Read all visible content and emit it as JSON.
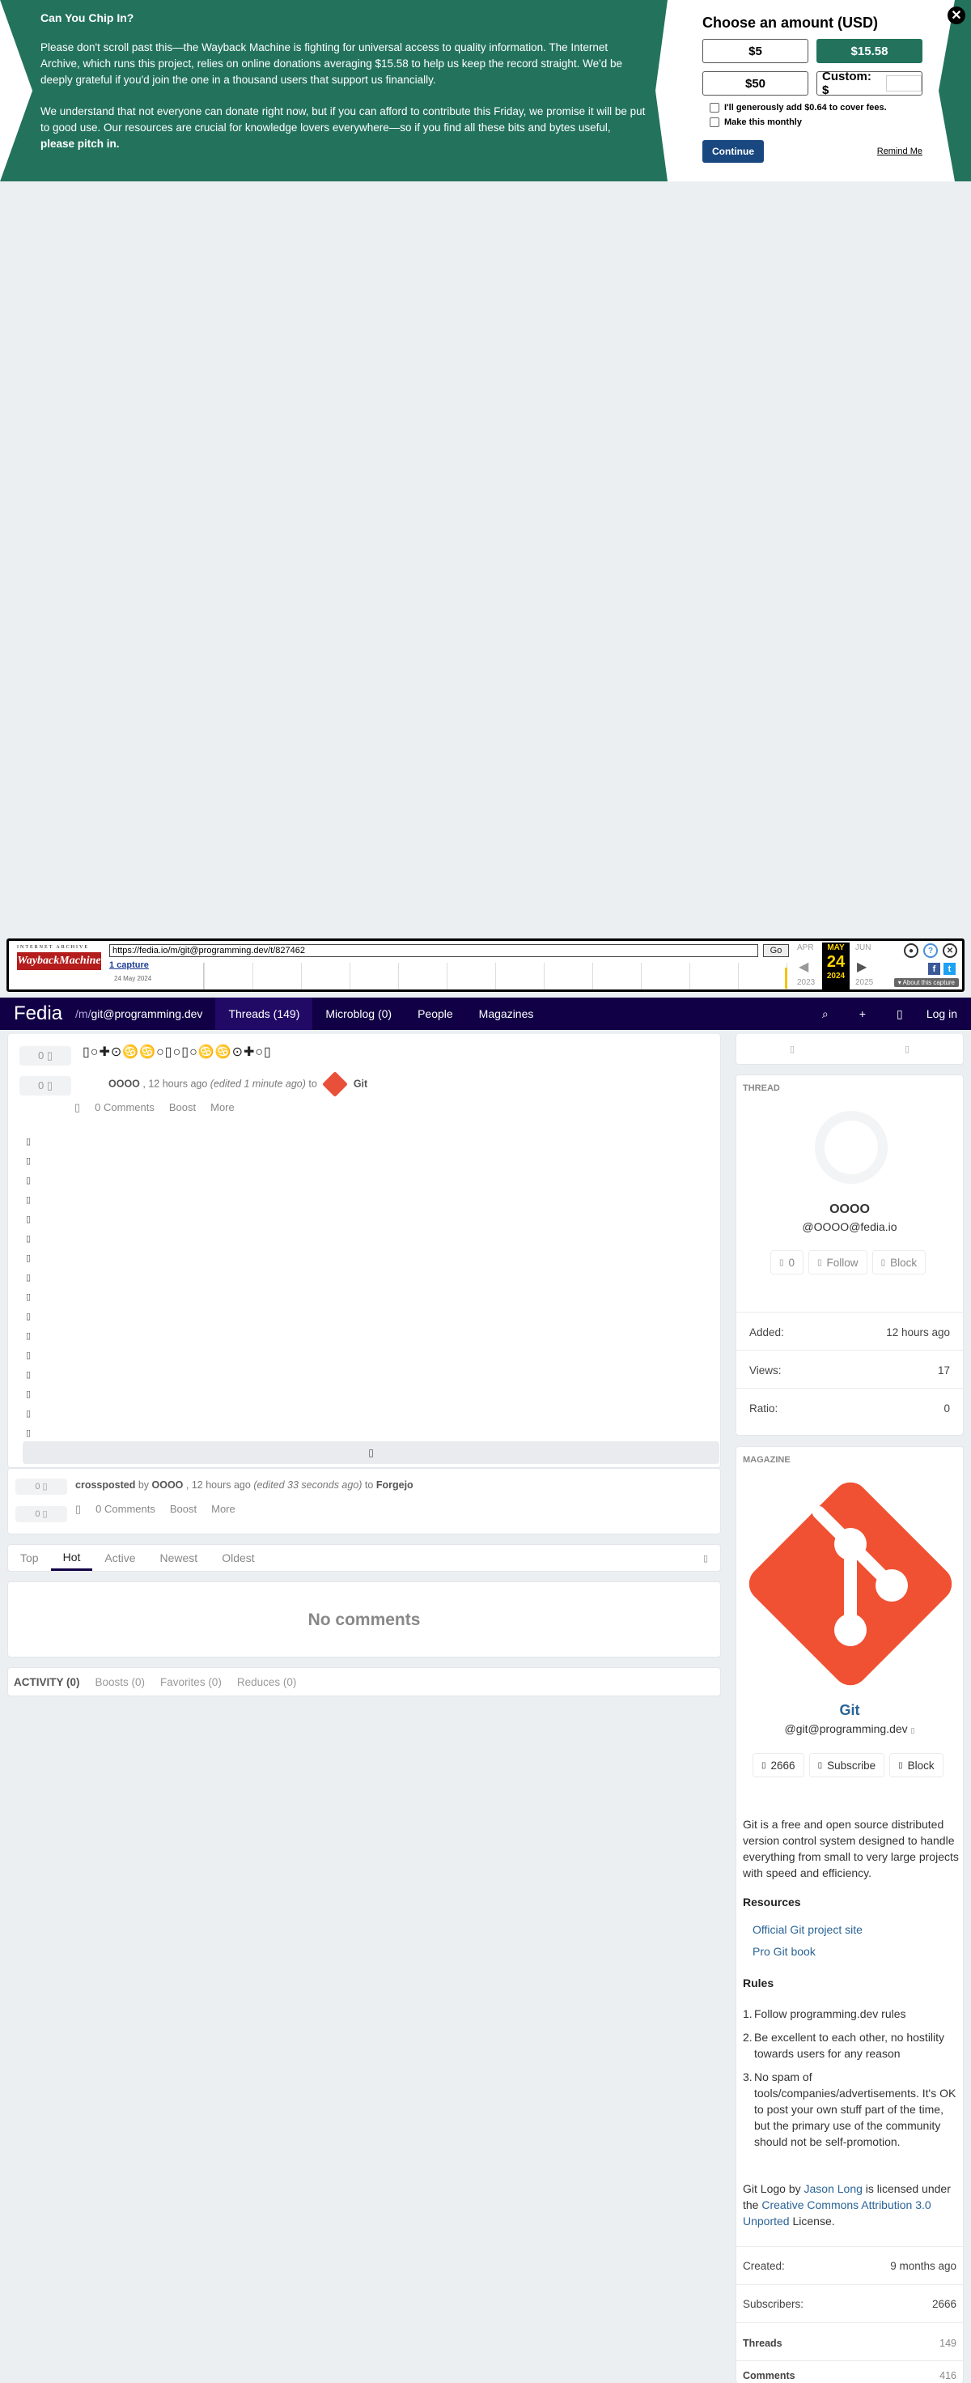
{
  "donate": {
    "heading": "Can You Chip In?",
    "para1": "Please don't scroll past this—the Wayback Machine is fighting for universal access to quality information. The Internet Archive, which runs this project, relies on online donations averaging $15.58 to help us keep the record straight. We'd be deeply grateful if you'd join the one in a thousand users that support us financially.",
    "para2": "We understand that not everyone can donate right now, but if you can afford to contribute this Friday, we promise it will be put to good use. Our resources are crucial for knowledge lovers everywhere—so if you find all these bits and bytes useful,",
    "para2_bold": "please pitch in.",
    "choose": "Choose an amount (USD)",
    "amounts": [
      "$5",
      "$15.58",
      "$50"
    ],
    "custom_label": "Custom: $",
    "cover_fees": "I'll generously add $0.64 to cover fees.",
    "monthly": "Make this monthly",
    "continue": "Continue",
    "remind": "Remind Me",
    "close": "✕",
    "accent": "#23735c"
  },
  "wayback": {
    "logo_top": "INTERNET ARCHIVE",
    "logo_main": "WaybackMachine",
    "url": "https://fedia.io/m/git@programming.dev/t/827462",
    "go": "Go",
    "captures": "1 capture",
    "capture_date": "24 May 2024",
    "prev_month": "APR",
    "cur_month": "MAY",
    "next_month": "JUN",
    "day": "24",
    "prev_year": "2023",
    "cur_year": "2024",
    "next_year": "2025",
    "about": "▾ About this capture"
  },
  "nav": {
    "brand": "Fedia",
    "magazine_prefix": "/m/",
    "magazine": "git@programming.dev",
    "tabs": [
      "Threads (149)",
      "Microblog (0)",
      "People",
      "Magazines"
    ],
    "login": "Log in"
  },
  "thread": {
    "title": "▯○✚⊙♋♋○▯○▯○♋♋⊙✚○▯",
    "score": "0",
    "author": "OOOO",
    "time": "12 hours ago",
    "edited": "(edited 1 minute ago)",
    "to": "to",
    "magazine": "Git",
    "comments": "0 Comments",
    "boost": "Boost",
    "more": "More",
    "body_glyphs": [
      "▯",
      "▯",
      "▯",
      "▯",
      "▯",
      "▯",
      "▯",
      "▯",
      "▯",
      "▯",
      "▯",
      "▯",
      "▯",
      "▯",
      "▯",
      "▯"
    ]
  },
  "crosspost": {
    "score": "0",
    "label": "crossposted",
    "by": "by",
    "author": "OOOO",
    "time": "12 hours ago",
    "edited": "(edited 33 seconds ago)",
    "to": "to",
    "magazine": "Forgejo",
    "comments": "0 Comments",
    "boost": "Boost",
    "more": "More"
  },
  "sort": [
    "Top",
    "Hot",
    "Active",
    "Newest",
    "Oldest"
  ],
  "no_comments": "No comments",
  "activity": [
    "ACTIVITY (0)",
    "Boosts (0)",
    "Favorites (0)",
    "Reduces (0)"
  ],
  "sidebar": {
    "thread_title": "THREAD",
    "user_name": "OOOO",
    "user_handle": "@OOOO@fedia.io",
    "user_followers": "0",
    "follow": "Follow",
    "block": "Block",
    "added_label": "Added:",
    "added": "12 hours ago",
    "views_label": "Views:",
    "views": "17",
    "ratio_label": "Ratio:",
    "ratio": "0",
    "magazine_title": "MAGAZINE",
    "mag_name": "Git",
    "mag_handle": "@git@programming.dev",
    "mag_subs": "2666",
    "subscribe": "Subscribe",
    "mag_block": "Block",
    "description": "Git is a free and open source distributed version control system designed to handle everything from small to very large projects with speed and efficiency.",
    "resources_title": "Resources",
    "resources": [
      "Official Git project site",
      "Pro Git book"
    ],
    "rules_title": "Rules",
    "rules": [
      "Follow programming.dev rules",
      "Be excellent to each other, no hostility towards users for any reason",
      "No spam of tools/companies/advertisements. It's OK to post your own stuff part of the time, but the primary use of the community should not be self-promotion."
    ],
    "credit_pre": "Git Logo by",
    "credit_author": "Jason Long",
    "credit_mid": "is licensed under the",
    "credit_license": "Creative Commons Attribution 3.0 Unported",
    "credit_post": "License.",
    "created_label": "Created:",
    "created": "9 months ago",
    "subscribers_label": "Subscribers:",
    "subscribers": "2666",
    "threads_label": "Threads",
    "threads": "149",
    "comments_label": "Comments",
    "comments": "416"
  }
}
